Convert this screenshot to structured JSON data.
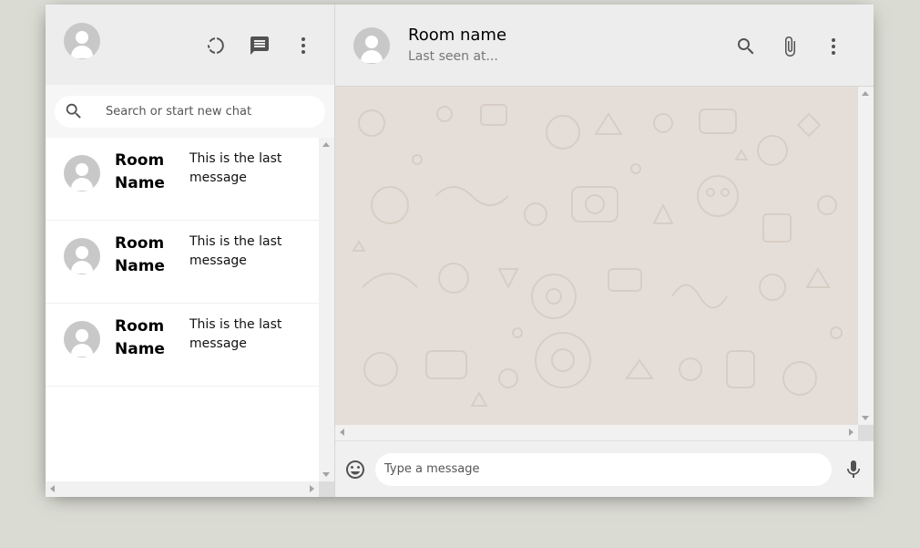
{
  "sidebar": {
    "search_placeholder": "Search or start new chat",
    "chats": [
      {
        "name": "Room Name",
        "last_message": "This is the last message"
      },
      {
        "name": "Room Name",
        "last_message": "This is the last message"
      },
      {
        "name": "Room Name",
        "last_message": "This is the last message"
      }
    ],
    "icons": [
      "avatar",
      "status-icon",
      "chat-icon",
      "more-vert-icon",
      "search-icon"
    ]
  },
  "chat": {
    "room_name": "Room name",
    "last_seen": "Last seen at...",
    "message_placeholder": "Type a message",
    "icons": [
      "search-icon",
      "attach-icon",
      "more-vert-icon",
      "emoji-icon",
      "mic-icon"
    ]
  },
  "colors": {
    "page_background": "#dadbd3",
    "header_background": "#ededed",
    "chat_wallpaper": "#e5ded8",
    "icon_color": "#525252"
  }
}
